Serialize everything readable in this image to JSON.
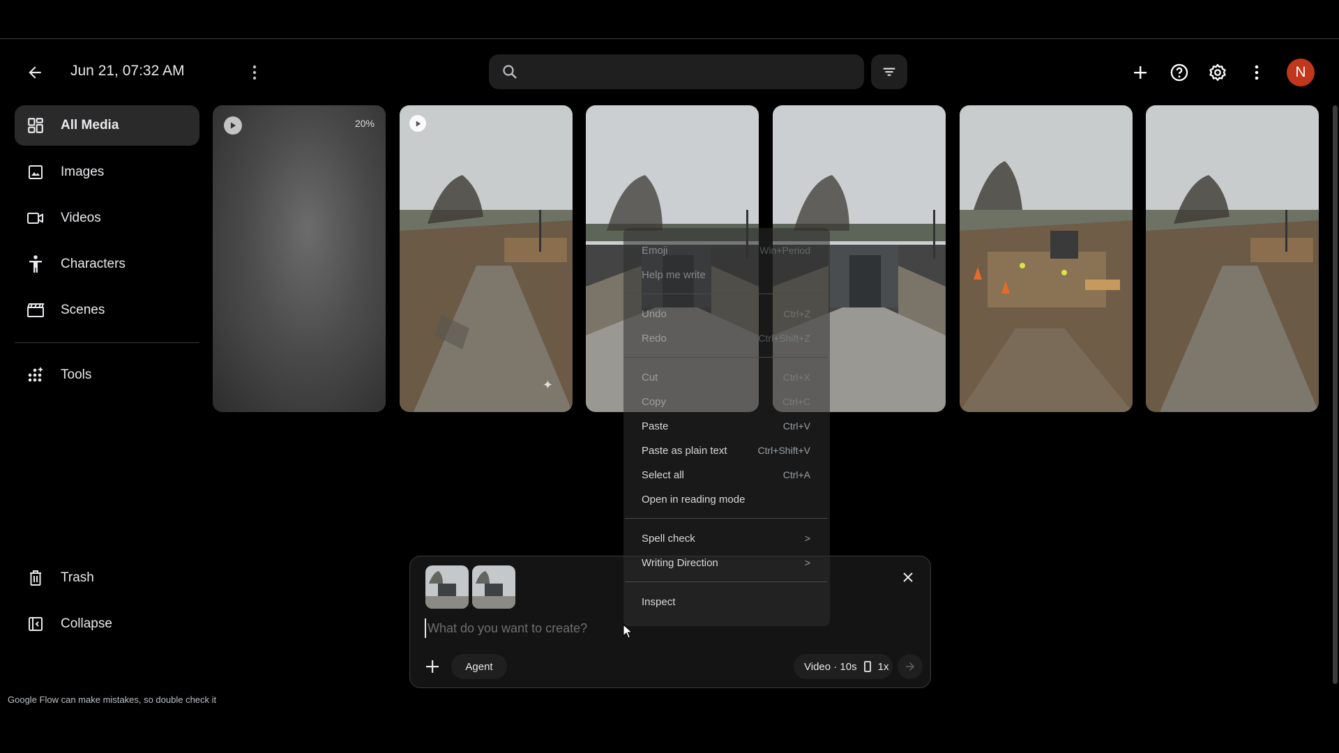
{
  "header": {
    "date_title": "Jun 21, 07:32 AM",
    "avatar_letter": "N"
  },
  "search": {
    "placeholder": ""
  },
  "sidebar": {
    "items": [
      {
        "label": "All Media",
        "icon": "grid-icon"
      },
      {
        "label": "Images",
        "icon": "image-icon"
      },
      {
        "label": "Videos",
        "icon": "video-icon"
      },
      {
        "label": "Characters",
        "icon": "person-icon"
      },
      {
        "label": "Scenes",
        "icon": "clapperboard-icon"
      },
      {
        "label": "Tools",
        "icon": "tools-sparkle-icon"
      }
    ],
    "bottom_items": [
      {
        "label": "Trash",
        "icon": "trash-icon"
      },
      {
        "label": "Collapse",
        "icon": "collapse-icon"
      }
    ],
    "disclaimer": "Google Flow can make mistakes, so double check it"
  },
  "gallery": {
    "tiles": [
      {
        "kind": "video-generating",
        "progress_label": "20%"
      },
      {
        "kind": "video",
        "scene": "construction site with dirt road"
      },
      {
        "kind": "image",
        "scene": "finished building entrance"
      },
      {
        "kind": "image",
        "scene": "finished building entrance"
      },
      {
        "kind": "image",
        "scene": "construction site with workers"
      },
      {
        "kind": "image",
        "scene": "construction site with dirt road"
      }
    ]
  },
  "composer": {
    "placeholder": "What do you want to create?",
    "value": "",
    "agent_label": "Agent",
    "settings_label": "Video · 10s",
    "multiplier_label": "1x"
  },
  "context_menu": {
    "items": [
      {
        "label": "Emoji",
        "shortcut": "Win+Period",
        "faded": true
      },
      {
        "label": "Help me write",
        "shortcut": "",
        "faded": true
      },
      {
        "label": "Undo",
        "shortcut": "Ctrl+Z",
        "faded": true
      },
      {
        "label": "Redo",
        "shortcut": "Ctrl+Shift+Z",
        "faded": true
      },
      {
        "label": "Cut",
        "shortcut": "Ctrl+X",
        "faded": true
      },
      {
        "label": "Copy",
        "shortcut": "Ctrl+C",
        "faded": true
      },
      {
        "label": "Paste",
        "shortcut": "Ctrl+V",
        "faded": false
      },
      {
        "label": "Paste as plain text",
        "shortcut": "Ctrl+Shift+V",
        "faded": false
      },
      {
        "label": "Select all",
        "shortcut": "Ctrl+A",
        "faded": false
      },
      {
        "label": "Open in reading mode",
        "shortcut": "",
        "faded": false
      },
      {
        "label": "Spell check",
        "shortcut": ">",
        "faded": false
      },
      {
        "label": "Writing Direction",
        "shortcut": ">",
        "faded": false
      },
      {
        "label": "Inspect",
        "shortcut": "",
        "faded": false
      }
    ]
  },
  "colors": {
    "background": "#000000",
    "surface": "#1f1f1f",
    "active_nav": "#2a2a2a",
    "avatar": "#c2361b",
    "text": "#e8eaed"
  }
}
